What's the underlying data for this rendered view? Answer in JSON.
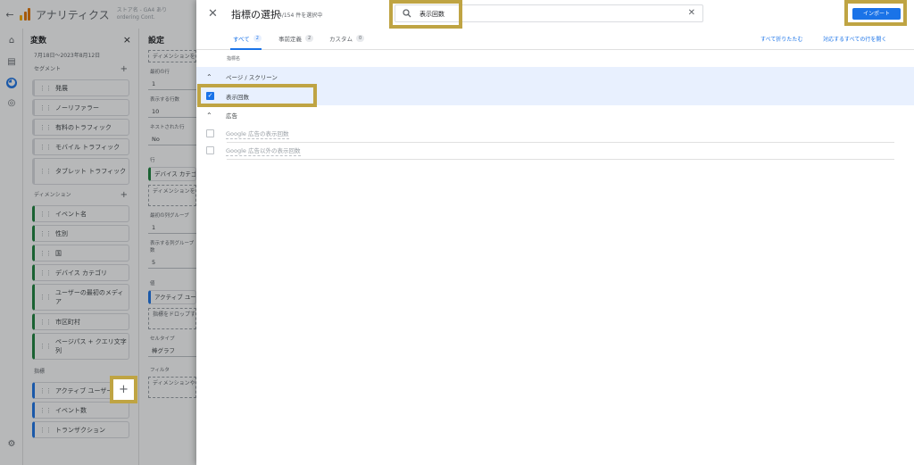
{
  "app": {
    "title": "アナリティクス",
    "account_line1": "ストア名 - GA4 あり",
    "account_line2": "ordering  Cont."
  },
  "variables_panel": {
    "title": "変数",
    "date_range": "7月18日～2023年8月12日",
    "segments_label": "セグメント",
    "segments": [
      "発展",
      "ノーリファラー",
      "有料のトラフィック",
      "モバイル トラフィック",
      "タブレット トラフィック"
    ],
    "dimensions_label": "ディメンション",
    "dimensions": [
      "イベント名",
      "性別",
      "国",
      "デバイス カテゴリ",
      "ユーザーの最初のメディア",
      "市区町村",
      "ページパス + クエリ文字列"
    ],
    "metrics_label": "指標",
    "metrics": [
      "アクティブ ユーザー数",
      "イベント数",
      "トランザクション"
    ]
  },
  "settings_panel": {
    "title": "設定",
    "start_row_label": "最初の行",
    "start_row": "1",
    "rows_label": "表示する行数",
    "rows": "10",
    "nested_label": "ネストされた行",
    "nested": "No",
    "rows_section_label": "行",
    "rows_chip": "デバイス カテゴリ",
    "drop_dimension": "ディメンションをドロップするか選択",
    "col_group_start_label": "最初の列グループ",
    "col_group_start": "1",
    "col_group_count_label": "表示する列グループ数",
    "col_group_count": "5",
    "values_label": "値",
    "values_chip": "アクティブ ユーザー数",
    "drop_metric": "指標をドロップするか選択してください",
    "cell_type_label": "セルタイプ",
    "cell_type": "棒グラフ",
    "filter_label": "フィルタ",
    "drop_filter": "ディメンションや指標をドロップするか選択"
  },
  "dialog": {
    "title": "指標の選択",
    "count": "4/154 件を選択中",
    "search_value": "表示回数",
    "import_label": "インポート",
    "tabs": [
      {
        "label": "すべて",
        "count": "2"
      },
      {
        "label": "事前定義",
        "count": "2"
      },
      {
        "label": "カスタム",
        "count": "0"
      }
    ],
    "collapse_all": "すべて折りたたむ",
    "expand_all": "対応するすべての行を開く",
    "column_header": "指標名",
    "groups": [
      {
        "label": "ページ / スクリーン",
        "items": [
          {
            "label": "表示回数",
            "checked": true
          }
        ]
      },
      {
        "label": "広告",
        "items": [
          {
            "label": "Google 広告の表示回数",
            "checked": false
          },
          {
            "label": "Google 広告以外の表示回数",
            "checked": false
          }
        ]
      }
    ]
  },
  "colors": {
    "accent": "#1a73e8",
    "highlight_frame": "#bfa443",
    "selected_row": "#e8f0fe"
  }
}
